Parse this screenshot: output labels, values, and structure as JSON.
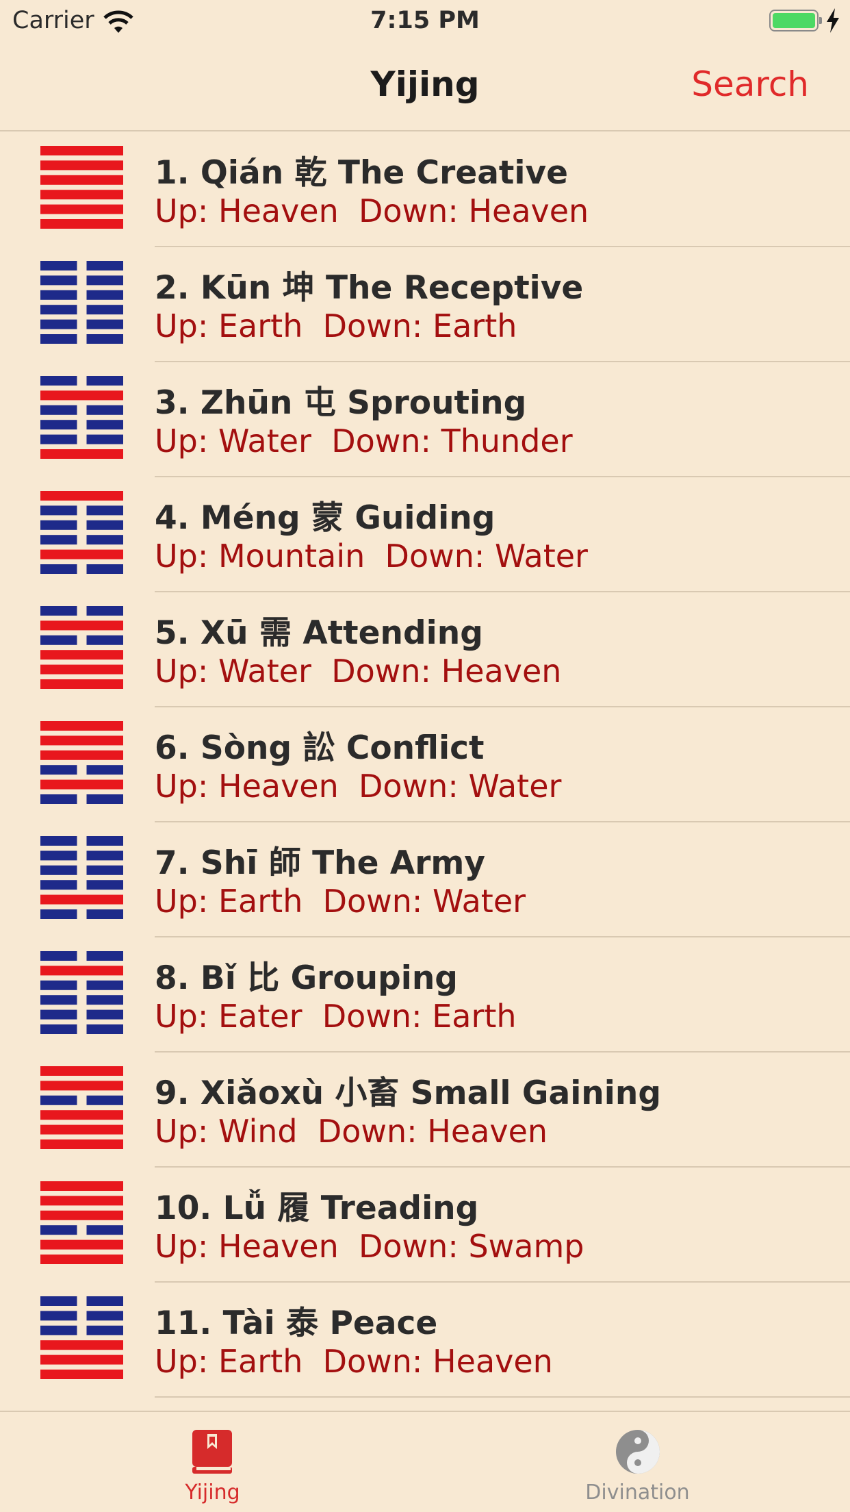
{
  "status_bar": {
    "carrier": "Carrier",
    "time": "7:15 PM"
  },
  "nav": {
    "title": "Yijing",
    "search_label": "Search"
  },
  "colors": {
    "yang_red": "#e8171d",
    "yin_blue": "#1e2a8a",
    "accent": "#e02a2a",
    "subtitle": "#a30f0f"
  },
  "hexagrams": [
    {
      "title": "1. Qián 乾 The Creative",
      "subtitle": "Up: Heaven  Down: Heaven",
      "lines": [
        1,
        1,
        1,
        1,
        1,
        1
      ]
    },
    {
      "title": "2. Kūn 坤 The Receptive",
      "subtitle": "Up: Earth  Down: Earth",
      "lines": [
        0,
        0,
        0,
        0,
        0,
        0
      ]
    },
    {
      "title": "3. Zhūn 屯 Sprouting",
      "subtitle": "Up: Water  Down: Thunder",
      "lines": [
        0,
        1,
        0,
        0,
        0,
        1
      ]
    },
    {
      "title": "4. Méng 蒙 Guiding",
      "subtitle": "Up: Mountain  Down: Water",
      "lines": [
        1,
        0,
        0,
        0,
        1,
        0
      ]
    },
    {
      "title": "5. Xū 需 Attending",
      "subtitle": "Up: Water  Down: Heaven",
      "lines": [
        0,
        1,
        0,
        1,
        1,
        1
      ]
    },
    {
      "title": "6. Sòng 訟 Conflict",
      "subtitle": "Up: Heaven  Down: Water",
      "lines": [
        1,
        1,
        1,
        0,
        1,
        0
      ]
    },
    {
      "title": "7. Shī 師 The Army",
      "subtitle": "Up: Earth  Down: Water",
      "lines": [
        0,
        0,
        0,
        0,
        1,
        0
      ]
    },
    {
      "title": "8. Bǐ 比 Grouping",
      "subtitle": "Up: Eater  Down: Earth",
      "lines": [
        0,
        1,
        0,
        0,
        0,
        0
      ]
    },
    {
      "title": "9. Xiǎoxù 小畜 Small Gaining",
      "subtitle": "Up: Wind  Down: Heaven",
      "lines": [
        1,
        1,
        0,
        1,
        1,
        1
      ]
    },
    {
      "title": "10. Lǚ 履 Treading",
      "subtitle": "Up: Heaven  Down: Swamp",
      "lines": [
        1,
        1,
        1,
        0,
        1,
        1
      ]
    },
    {
      "title": "11. Tài 泰 Peace",
      "subtitle": "Up: Earth  Down: Heaven",
      "lines": [
        0,
        0,
        0,
        1,
        1,
        1
      ]
    }
  ],
  "tab_bar": {
    "tabs": [
      {
        "label": "Yijing",
        "icon": "book-icon",
        "selected": true
      },
      {
        "label": "Divination",
        "icon": "yin-yang-icon",
        "selected": false
      }
    ]
  }
}
